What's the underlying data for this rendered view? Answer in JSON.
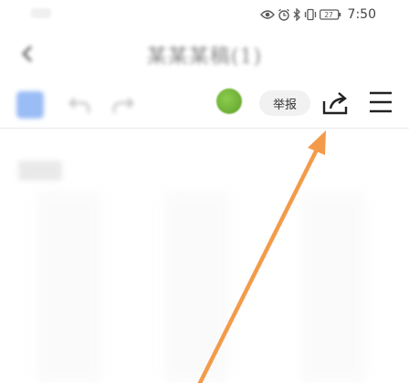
{
  "status_bar": {
    "battery_level": "27",
    "time": "7:50"
  },
  "title_bar": {
    "title": "某某某稿(1)"
  },
  "toolbar": {
    "report_label": "举报"
  },
  "content": {
    "first_line": "新建"
  },
  "colors": {
    "accent_blue": "#79a7f3",
    "avatar_green": "#6fb33a",
    "annotation_orange": "#f39b4a"
  },
  "icons": {
    "share": "share-icon",
    "menu": "menu-icon",
    "back": "back-arrow-icon",
    "undo": "undo-icon",
    "redo": "redo-icon"
  }
}
